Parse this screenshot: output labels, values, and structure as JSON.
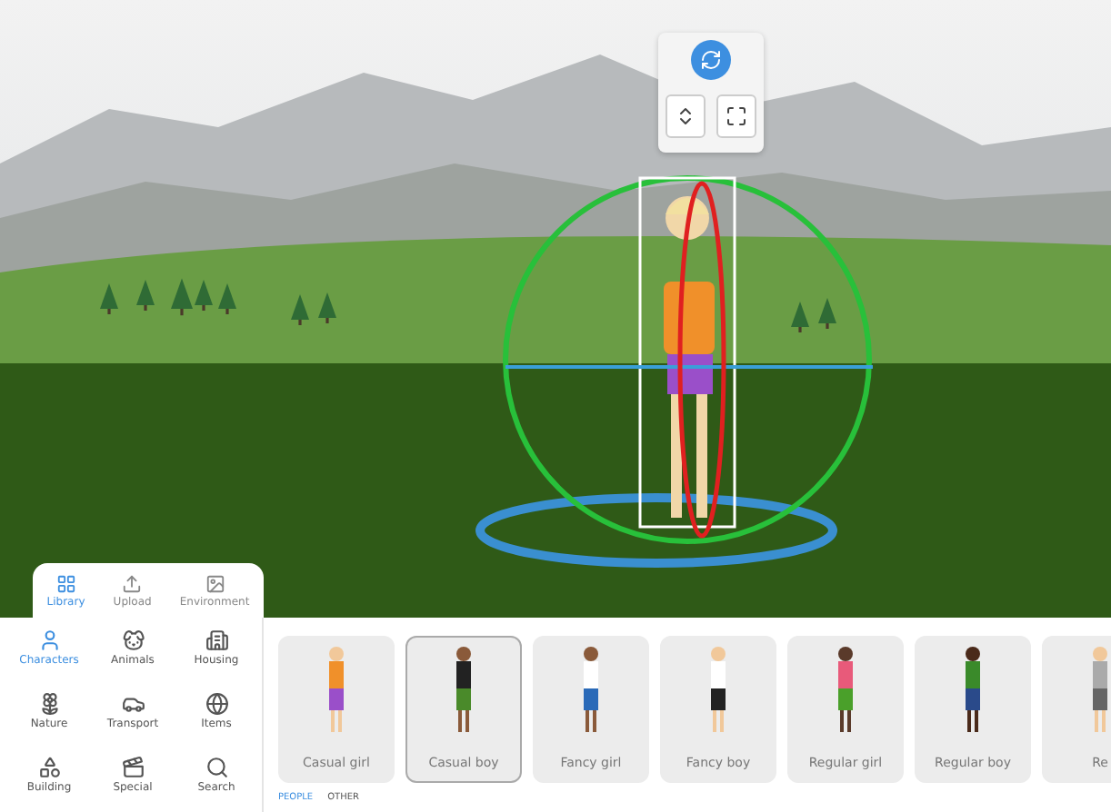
{
  "panel_tabs": [
    {
      "label": "Library",
      "selected": true
    },
    {
      "label": "Upload",
      "selected": false
    },
    {
      "label": "Environment",
      "selected": false
    }
  ],
  "categories": [
    {
      "label": "Characters",
      "selected": true
    },
    {
      "label": "Animals",
      "selected": false
    },
    {
      "label": "Housing",
      "selected": false
    },
    {
      "label": "Nature",
      "selected": false
    },
    {
      "label": "Transport",
      "selected": false
    },
    {
      "label": "Items",
      "selected": false
    },
    {
      "label": "Building",
      "selected": false
    },
    {
      "label": "Special",
      "selected": false
    },
    {
      "label": "Search",
      "selected": false
    }
  ],
  "characters": [
    {
      "label": "Casual girl",
      "selected": false
    },
    {
      "label": "Casual boy",
      "selected": true
    },
    {
      "label": "Fancy girl",
      "selected": false
    },
    {
      "label": "Fancy boy",
      "selected": false
    },
    {
      "label": "Regular girl",
      "selected": false
    },
    {
      "label": "Regular boy",
      "selected": false
    },
    {
      "label": "Re",
      "selected": false
    }
  ],
  "filters": [
    {
      "label": "PEOPLE",
      "selected": true
    },
    {
      "label": "OTHER",
      "selected": false
    }
  ]
}
